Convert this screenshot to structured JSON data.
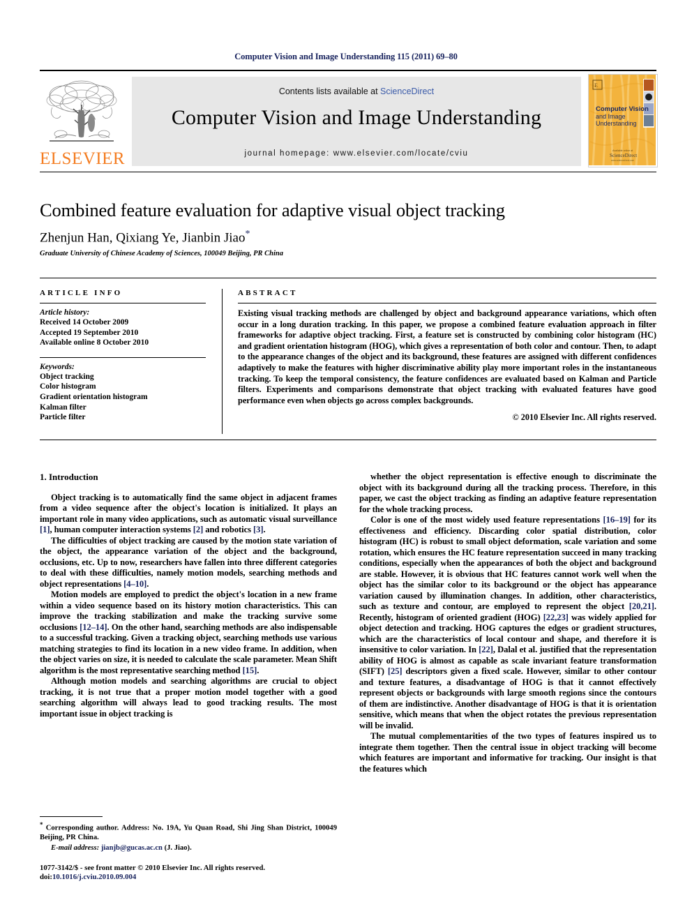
{
  "running_head": "Computer Vision and Image Understanding 115 (2011) 69–80",
  "masthead": {
    "publisher_name": "ELSEVIER",
    "contents_prefix": "Contents lists available at ",
    "contents_link": "ScienceDirect",
    "journal_title": "Computer Vision and Image Understanding",
    "homepage": "journal homepage: www.elsevier.com/locate/cviu",
    "cover": {
      "line1": "Computer Vision",
      "line2": "and Image",
      "line3": "Understanding",
      "footer": "Available online at",
      "footer2": "ScienceDirect"
    },
    "colors": {
      "elsevier_orange": "#f47c20",
      "banner_gray": "#e7e7e7",
      "link_blue": "#3b5ba9",
      "cover_orange": "#f3b33d"
    }
  },
  "article": {
    "title": "Combined feature evaluation for adaptive visual object tracking",
    "authors": "Zhenjun Han, Qixiang Ye, Jianbin Jiao",
    "corresponding_marker": "*",
    "affiliation": "Graduate University of Chinese Academy of Sciences, 100049 Beijing, PR China"
  },
  "info": {
    "heading": "ARTICLE INFO",
    "history_label": "Article history:",
    "history": [
      "Received 14 October 2009",
      "Accepted 19 September 2010",
      "Available online 8 October 2010"
    ],
    "keywords_label": "Keywords:",
    "keywords": [
      "Object tracking",
      "Color histogram",
      "Gradient orientation histogram",
      "Kalman filter",
      "Particle filter"
    ]
  },
  "abstract": {
    "heading": "ABSTRACT",
    "body": "Existing visual tracking methods are challenged by object and background appearance variations, which often occur in a long duration tracking. In this paper, we propose a combined feature evaluation approach in filter frameworks for adaptive object tracking. First, a feature set is constructed by combining color histogram (HC) and gradient orientation histogram (HOG), which gives a representation of both color and contour. Then, to adapt to the appearance changes of the object and its background, these features are assigned with different confidences adaptively to make the features with higher discriminative ability play more important roles in the instantaneous tracking. To keep the temporal consistency, the feature confidences are evaluated based on Kalman and Particle filters. Experiments and comparisons demonstrate that object tracking with evaluated features have good performance even when objects go across complex backgrounds.",
    "copyright": "© 2010 Elsevier Inc. All rights reserved."
  },
  "body": {
    "section_heading": "1. Introduction",
    "left_paragraphs": [
      "Object tracking is to automatically find the same object in adjacent frames from a video sequence after the object's location is initialized. It plays an important role in many video applications, such as automatic visual surveillance [1], human computer interaction systems [2] and robotics [3].",
      "The difficulties of object tracking are caused by the motion state variation of the object, the appearance variation of the object and the background, occlusions, etc. Up to now, researchers have fallen into three different categories to deal with these difficulties, namely motion models, searching methods and object representations [4–10].",
      "Motion models are employed to predict the object's location in a new frame within a video sequence based on its history motion characteristics. This can improve the tracking stabilization and make the tracking survive some occlusions [12–14]. On the other hand, searching methods are also indispensable to a successful tracking. Given a tracking object, searching methods use various matching strategies to find its location in a new video frame. In addition, when the object varies on size, it is needed to calculate the scale parameter. Mean Shift algorithm is the most representative searching method [15].",
      "Although motion models and searching algorithms are crucial to object tracking, it is not true that a proper motion model together with a good searching algorithm will always lead to good tracking results. The most important issue in object tracking is"
    ],
    "right_paragraphs": [
      "whether the object representation is effective enough to discriminate the object with its background during all the tracking process. Therefore, in this paper, we cast the object tracking as finding an adaptive feature representation for the whole tracking process.",
      "Color is one of the most widely used feature representations [16–19] for its effectiveness and efficiency. Discarding color spatial distribution, color histogram (HC) is robust to small object deformation, scale variation and some rotation, which ensures the HC feature representation succeed in many tracking conditions, especially when the appearances of both the object and background are stable. However, it is obvious that HC features cannot work well when the object has the similar color to its background or the object has appearance variation caused by illumination changes. In addition, other characteristics, such as texture and contour, are employed to represent the object [20,21]. Recently, histogram of oriented gradient (HOG) [22,23] was widely applied for object detection and tracking. HOG captures the edges or gradient structures, which are the characteristics of local contour and shape, and therefore it is insensitive to color variation. In [22], Dalal et al. justified that the representation ability of HOG is almost as capable as scale invariant feature transformation (SIFT) [25] descriptors given a fixed scale. However, similar to other contour and texture features, a disadvantage of HOG is that it cannot effectively represent objects or backgrounds with large smooth regions since the contours of them are indistinctive. Another disadvantage of HOG is that it is orientation sensitive, which means that when the object rotates the previous representation will be invalid.",
      "The mutual complementarities of the two types of features inspired us to integrate them together. Then the central issue in object tracking will become which features are important and informative for tracking. Our insight is that the features which"
    ]
  },
  "footnote": {
    "marker": "*",
    "text": " Corresponding author. Address: No. 19A, Yu Quan Road, Shi Jing Shan District, 100049 Beijing, PR China.",
    "email_label": "E-mail address:",
    "email": "jianjb@gucas.ac.cn",
    "email_suffix": " (J. Jiao)."
  },
  "footer": {
    "issn_line": "1077-3142/$ - see front matter © 2010 Elsevier Inc. All rights reserved.",
    "doi_label": "doi:",
    "doi_value": "10.1016/j.cviu.2010.09.004"
  }
}
